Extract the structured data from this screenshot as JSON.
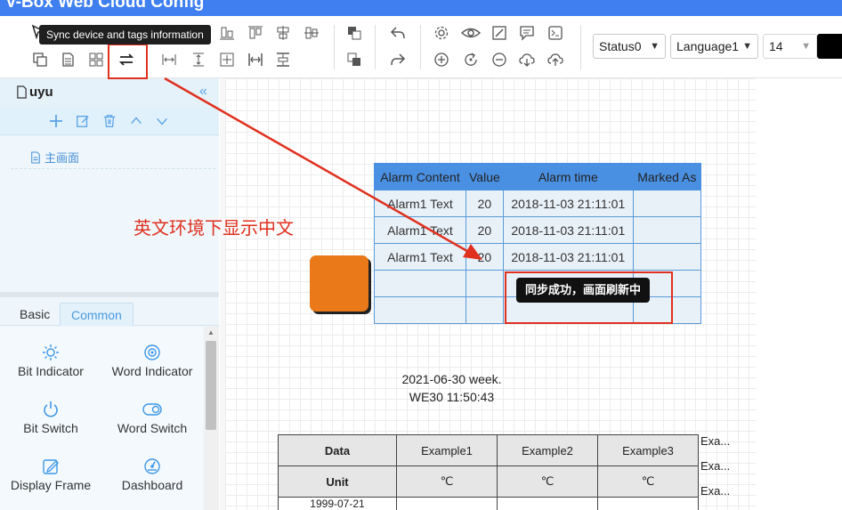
{
  "window": {
    "title": "V-Box Web Cloud Config"
  },
  "toolbar": {
    "tooltip": "Sync device and tags information",
    "status_select": "Status0",
    "language_select": "Language1",
    "font_size": "14"
  },
  "sidebar": {
    "project_name": "uyu",
    "tree_items": [
      "主画面"
    ],
    "tabs": [
      "Basic",
      "Common"
    ],
    "widgets": [
      "Bit Indicator",
      "Word Indicator",
      "Bit Switch",
      "Word Switch",
      "Display Frame",
      "Dashboard"
    ]
  },
  "canvas": {
    "alarm_table": {
      "headers": [
        "Alarm Content",
        "Value",
        "Alarm time",
        "Marked As"
      ],
      "rows": [
        [
          "Alarm1 Text",
          "20",
          "2018-11-03 21:11:01",
          ""
        ],
        [
          "Alarm1 Text",
          "20",
          "2018-11-03 21:11:01",
          ""
        ],
        [
          "Alarm1 Text",
          "20",
          "2018-11-03 21:11:01",
          ""
        ]
      ]
    },
    "datetime_line1": "2021-06-30 week.",
    "datetime_line2": "WE30 11:50:43",
    "data_table": {
      "row1": [
        "Data",
        "Example1",
        "Example2",
        "Example3"
      ],
      "row2": [
        "Unit",
        "℃",
        "℃",
        "℃"
      ],
      "row3_partial": "1999-07-21"
    },
    "side_labels": [
      "Exa...",
      "Exa...",
      "Exa..."
    ]
  },
  "annotation": {
    "overlay_text": "英文环境下显示中文",
    "toast": "同步成功，画面刷新中",
    "color": "#e0301e"
  }
}
